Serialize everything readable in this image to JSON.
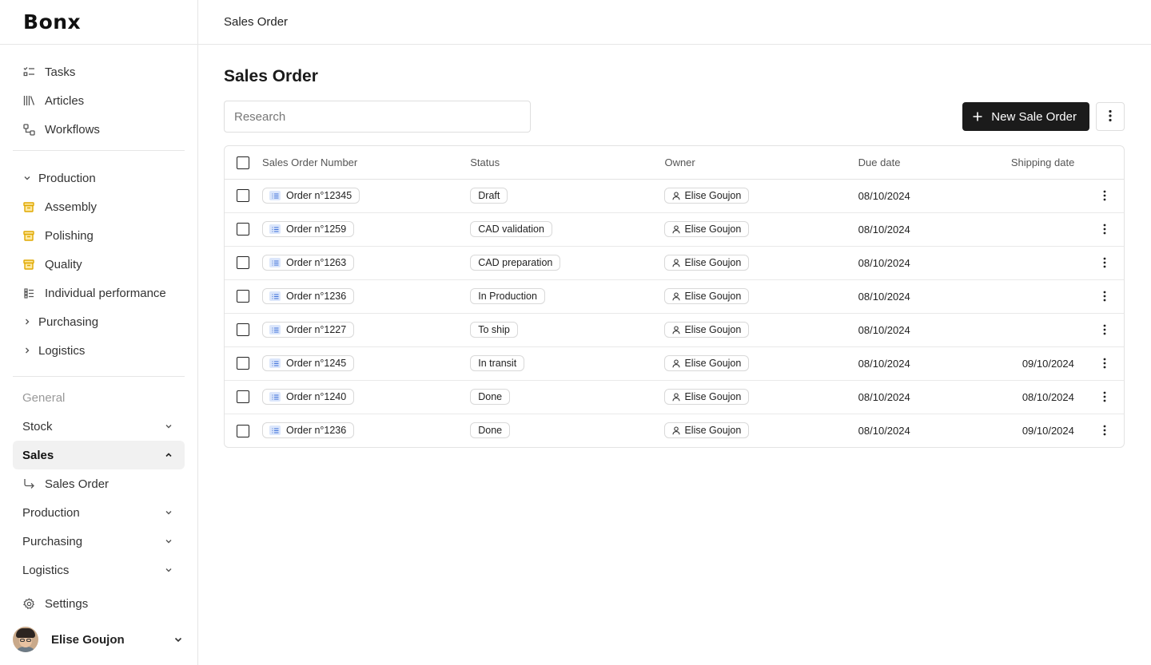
{
  "brand": {
    "logo_text": "Bonx"
  },
  "sidebar": {
    "workspace_items": [
      {
        "label": "Tasks",
        "icon": "tasks-icon"
      },
      {
        "label": "Articles",
        "icon": "articles-icon"
      },
      {
        "label": "Workflows",
        "icon": "workflows-icon"
      }
    ],
    "production_section": {
      "label": "Production",
      "items": [
        {
          "label": "Assembly",
          "icon": "archive-box-icon"
        },
        {
          "label": "Polishing",
          "icon": "archive-box-icon"
        },
        {
          "label": "Quality",
          "icon": "archive-box-icon"
        },
        {
          "label": "Individual performance",
          "icon": "performance-icon"
        }
      ]
    },
    "purchasing_label": "Purchasing",
    "logistics_label": "Logistics",
    "general_header": "General",
    "general_items": {
      "stock": "Stock",
      "sales": "Sales",
      "sales_order": "Sales Order",
      "production": "Production",
      "purchasing": "Purchasing",
      "logistics": "Logistics"
    },
    "settings_label": "Settings",
    "user_name": "Elise Goujon"
  },
  "topbar": {
    "breadcrumb": "Sales Order"
  },
  "page": {
    "title": "Sales Order",
    "search_placeholder": "Research",
    "new_button_label": "New Sale Order"
  },
  "table": {
    "columns": {
      "number": "Sales Order Number",
      "status": "Status",
      "owner": "Owner",
      "due": "Due date",
      "shipping": "Shipping date"
    },
    "rows": [
      {
        "order": "Order n°12345",
        "status": "Draft",
        "owner": "Elise Goujon",
        "due": "08/10/2024",
        "shipping": ""
      },
      {
        "order": "Order n°1259",
        "status": "CAD validation",
        "owner": "Elise Goujon",
        "due": "08/10/2024",
        "shipping": ""
      },
      {
        "order": "Order n°1263",
        "status": "CAD preparation",
        "owner": "Elise Goujon",
        "due": "08/10/2024",
        "shipping": ""
      },
      {
        "order": "Order n°1236",
        "status": "In Production",
        "owner": "Elise Goujon",
        "due": "08/10/2024",
        "shipping": ""
      },
      {
        "order": "Order n°1227",
        "status": "To ship",
        "owner": "Elise Goujon",
        "due": "08/10/2024",
        "shipping": ""
      },
      {
        "order": "Order n°1245",
        "status": "In transit",
        "owner": "Elise Goujon",
        "due": "08/10/2024",
        "shipping": "09/10/2024"
      },
      {
        "order": "Order n°1240",
        "status": "Done",
        "owner": "Elise Goujon",
        "due": "08/10/2024",
        "shipping": "08/10/2024"
      },
      {
        "order": "Order n°1236",
        "status": "Done",
        "owner": "Elise Goujon",
        "due": "08/10/2024",
        "shipping": "09/10/2024"
      }
    ]
  }
}
